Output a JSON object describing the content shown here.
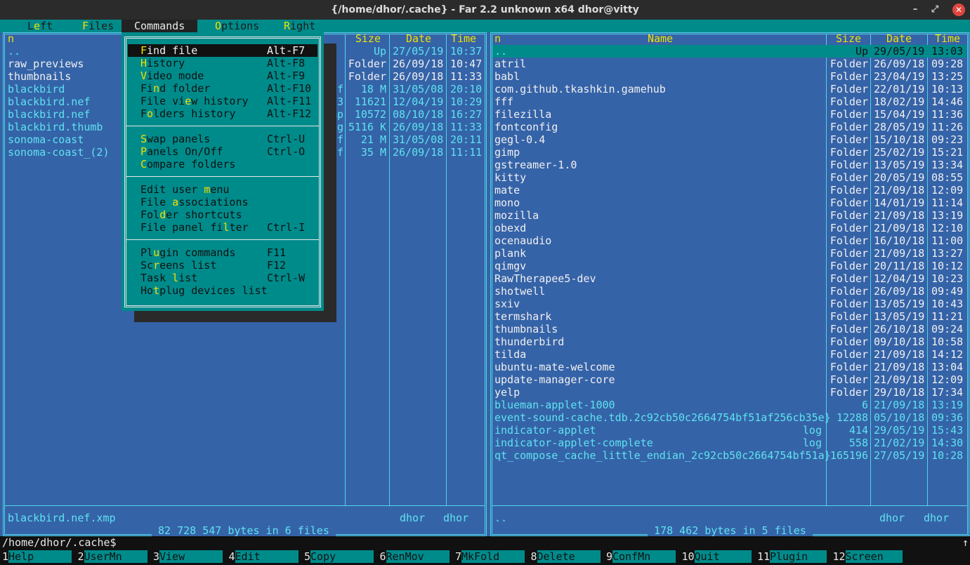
{
  "window": {
    "title": "{/home/dhor/.cache} - Far 2.2 unknown x64 dhor@vitty",
    "minimize": "–",
    "restore": "⤢",
    "close": "✕"
  },
  "menubar": {
    "items": [
      {
        "pre": "L",
        "hot": "e",
        "post": "ft"
      },
      {
        "pre": "",
        "hot": "F",
        "post": "iles"
      },
      {
        "pre": "",
        "hot": "C",
        "post": "ommands"
      },
      {
        "pre": "",
        "hot": "O",
        "post": "ptions"
      },
      {
        "pre": "",
        "hot": "R",
        "post": "ight"
      }
    ]
  },
  "left": {
    "col_name": "n",
    "col_size": "Size",
    "col_date": "Date",
    "col_time": "Time",
    "rows": [
      {
        "name": "..",
        "ext": "",
        "size": "Up",
        "date": "27/05/19",
        "time": "10:37",
        "cls": "cyan"
      },
      {
        "name": "raw_previews",
        "ext": "",
        "size": "Folder",
        "date": "26/09/18",
        "time": "10:47",
        "cls": "white"
      },
      {
        "name": "thumbnails",
        "ext": "",
        "size": "Folder",
        "date": "26/09/18",
        "time": "11:33",
        "cls": "white"
      },
      {
        "name": "blackbird",
        "ext": "nef",
        "size": "18 M",
        "date": "31/05/08",
        "time": "20:10",
        "cls": "cyan"
      },
      {
        "name": "blackbird.nef",
        "ext": "pp3",
        "size": "11621",
        "date": "12/04/19",
        "time": "10:29",
        "cls": "cyan"
      },
      {
        "name": "blackbird.nef",
        "ext": "xmp",
        "size": "10572",
        "date": "08/10/18",
        "time": "16:27",
        "cls": "cyan"
      },
      {
        "name": "blackbird.thumb",
        "ext": "jpg",
        "size": "5116 K",
        "date": "26/09/18",
        "time": "11:33",
        "cls": "cyan"
      },
      {
        "name": "sonoma-coast",
        "ext": "nef",
        "size": "21 M",
        "date": "31/05/08",
        "time": "20:11",
        "cls": "cyan"
      },
      {
        "name": "sonoma-coast_(2)",
        "ext": "iff",
        "size": "35 M",
        "date": "26/09/18",
        "time": "11:11",
        "cls": "cyan"
      }
    ],
    "current_file": "blackbird.nef.xmp",
    "owner1": "dhor",
    "owner2": "dhor",
    "summary": " 82 728 547 bytes in 6 files "
  },
  "right": {
    "col_name": "n",
    "col_name2": "Name",
    "col_size": "Size",
    "col_date": "Date",
    "col_time": "Time",
    "rows": [
      {
        "name": "..",
        "ext": "",
        "size": "Up",
        "date": "29/05/19",
        "time": "13:03",
        "cls": "sel"
      },
      {
        "name": "atril",
        "ext": "",
        "size": "Folder",
        "date": "26/09/18",
        "time": "09:28",
        "cls": "white"
      },
      {
        "name": "babl",
        "ext": "",
        "size": "Folder",
        "date": "23/04/19",
        "time": "13:25",
        "cls": "white"
      },
      {
        "name": "com.github.tkashkin.gamehub",
        "ext": "",
        "size": "Folder",
        "date": "22/01/19",
        "time": "10:13",
        "cls": "white"
      },
      {
        "name": "fff",
        "ext": "",
        "size": "Folder",
        "date": "18/02/19",
        "time": "14:46",
        "cls": "white"
      },
      {
        "name": "filezilla",
        "ext": "",
        "size": "Folder",
        "date": "15/04/19",
        "time": "11:36",
        "cls": "white"
      },
      {
        "name": "fontconfig",
        "ext": "",
        "size": "Folder",
        "date": "28/05/19",
        "time": "11:26",
        "cls": "white"
      },
      {
        "name": "gegl-0.4",
        "ext": "",
        "size": "Folder",
        "date": "15/10/18",
        "time": "09:23",
        "cls": "white"
      },
      {
        "name": "gimp",
        "ext": "",
        "size": "Folder",
        "date": "25/02/19",
        "time": "15:21",
        "cls": "white"
      },
      {
        "name": "gstreamer-1.0",
        "ext": "",
        "size": "Folder",
        "date": "13/05/19",
        "time": "13:34",
        "cls": "white"
      },
      {
        "name": "kitty",
        "ext": "",
        "size": "Folder",
        "date": "20/05/19",
        "time": "08:55",
        "cls": "white"
      },
      {
        "name": "mate",
        "ext": "",
        "size": "Folder",
        "date": "21/09/18",
        "time": "12:09",
        "cls": "white"
      },
      {
        "name": "mono",
        "ext": "",
        "size": "Folder",
        "date": "14/01/19",
        "time": "11:14",
        "cls": "white"
      },
      {
        "name": "mozilla",
        "ext": "",
        "size": "Folder",
        "date": "21/09/18",
        "time": "13:19",
        "cls": "white"
      },
      {
        "name": "obexd",
        "ext": "",
        "size": "Folder",
        "date": "21/09/18",
        "time": "12:10",
        "cls": "white"
      },
      {
        "name": "ocenaudio",
        "ext": "",
        "size": "Folder",
        "date": "16/10/18",
        "time": "11:00",
        "cls": "white"
      },
      {
        "name": "plank",
        "ext": "",
        "size": "Folder",
        "date": "21/09/18",
        "time": "13:27",
        "cls": "white"
      },
      {
        "name": "qimgv",
        "ext": "",
        "size": "Folder",
        "date": "20/11/18",
        "time": "10:12",
        "cls": "white"
      },
      {
        "name": "RawTherapee5-dev",
        "ext": "",
        "size": "Folder",
        "date": "12/04/19",
        "time": "10:23",
        "cls": "white"
      },
      {
        "name": "shotwell",
        "ext": "",
        "size": "Folder",
        "date": "26/09/18",
        "time": "09:49",
        "cls": "white"
      },
      {
        "name": "sxiv",
        "ext": "",
        "size": "Folder",
        "date": "13/05/19",
        "time": "10:43",
        "cls": "white"
      },
      {
        "name": "termshark",
        "ext": "",
        "size": "Folder",
        "date": "13/05/19",
        "time": "11:21",
        "cls": "white"
      },
      {
        "name": "thumbnails",
        "ext": "",
        "size": "Folder",
        "date": "26/10/18",
        "time": "09:24",
        "cls": "white"
      },
      {
        "name": "thunderbird",
        "ext": "",
        "size": "Folder",
        "date": "09/10/18",
        "time": "10:58",
        "cls": "white"
      },
      {
        "name": "tilda",
        "ext": "",
        "size": "Folder",
        "date": "21/09/18",
        "time": "14:12",
        "cls": "white"
      },
      {
        "name": "ubuntu-mate-welcome",
        "ext": "",
        "size": "Folder",
        "date": "21/09/18",
        "time": "13:04",
        "cls": "white"
      },
      {
        "name": "update-manager-core",
        "ext": "",
        "size": "Folder",
        "date": "21/09/18",
        "time": "12:09",
        "cls": "white"
      },
      {
        "name": "yelp",
        "ext": "",
        "size": "Folder",
        "date": "29/10/18",
        "time": "17:34",
        "cls": "white"
      },
      {
        "name": "blueman-applet-1000",
        "ext": "",
        "size": "6",
        "date": "21/09/18",
        "time": "13:19",
        "cls": "cyan"
      },
      {
        "name": "event-sound-cache.tdb.2c92cb50c2664754bf51af256cb35e}",
        "ext": "",
        "size": "12288",
        "date": "05/10/18",
        "time": "09:36",
        "cls": "cyan"
      },
      {
        "name": "indicator-applet",
        "ext": "log",
        "size": "414",
        "date": "29/05/19",
        "time": "15:43",
        "cls": "cyan"
      },
      {
        "name": "indicator-applet-complete",
        "ext": "log",
        "size": "558",
        "date": "21/02/19",
        "time": "14:30",
        "cls": "cyan"
      },
      {
        "name": "qt_compose_cache_little_endian_2c92cb50c2664754bf51a}",
        "ext": "",
        "size": "165196",
        "date": "27/05/19",
        "time": "10:28",
        "cls": "cyan"
      }
    ],
    "current_file": "..",
    "owner1": "dhor",
    "owner2": "dhor",
    "summary": " 178 462 bytes in 5 files "
  },
  "commands_menu": {
    "groups": [
      [
        {
          "pre": "",
          "hot": "F",
          "post": "ind file",
          "key": "Alt-F7",
          "selected": true
        },
        {
          "pre": "",
          "hot": "H",
          "post": "istory",
          "key": "Alt-F8"
        },
        {
          "pre": "",
          "hot": "V",
          "post": "ideo mode",
          "key": "Alt-F9"
        },
        {
          "pre": "Fi",
          "hot": "n",
          "post": "d folder",
          "key": "Alt-F10"
        },
        {
          "pre": "File vi",
          "hot": "e",
          "post": "w history",
          "key": "Alt-F11"
        },
        {
          "pre": "F",
          "hot": "o",
          "post": "lders history",
          "key": "Alt-F12"
        }
      ],
      [
        {
          "pre": "",
          "hot": "S",
          "post": "wap panels",
          "key": "Ctrl-U"
        },
        {
          "pre": "",
          "hot": "P",
          "post": "anels On/Off",
          "key": "Ctrl-O"
        },
        {
          "pre": "",
          "hot": "C",
          "post": "ompare folders",
          "key": ""
        }
      ],
      [
        {
          "pre": "Edit user ",
          "hot": "m",
          "post": "enu",
          "key": ""
        },
        {
          "pre": "File ",
          "hot": "a",
          "post": "ssociations",
          "key": ""
        },
        {
          "pre": "Fol",
          "hot": "d",
          "post": "er shortcuts",
          "key": ""
        },
        {
          "pre": "File panel fi",
          "hot": "l",
          "post": "ter",
          "key": "Ctrl-I"
        }
      ],
      [
        {
          "pre": "Pl",
          "hot": "u",
          "post": "gin commands",
          "key": "F11"
        },
        {
          "pre": "Sc",
          "hot": "r",
          "post": "eens list",
          "key": "F12"
        },
        {
          "pre": "Task ",
          "hot": "l",
          "post": "ist",
          "key": "Ctrl-W"
        },
        {
          "pre": "Ho",
          "hot": "t",
          "post": "plug devices list",
          "key": ""
        }
      ]
    ]
  },
  "cmdline": {
    "prompt": "/home/dhor/.cache$",
    "scroll": "↑"
  },
  "keybar": [
    {
      "num": "1",
      "label": "Help"
    },
    {
      "num": "2",
      "label": "UserMn"
    },
    {
      "num": "3",
      "label": "View"
    },
    {
      "num": "4",
      "label": "Edit"
    },
    {
      "num": "5",
      "label": "Copy"
    },
    {
      "num": "6",
      "label": "RenMov"
    },
    {
      "num": "7",
      "label": "MkFold"
    },
    {
      "num": "8",
      "label": "Delete"
    },
    {
      "num": "9",
      "label": "ConfMn"
    },
    {
      "num": "10",
      "label": "Quit"
    },
    {
      "num": "11",
      "label": "Plugin"
    },
    {
      "num": "12",
      "label": "Screen"
    }
  ],
  "colors": {
    "panel_bg": "#3563a8",
    "frame": "#4fd6e6",
    "menu_bg": "#008b8b",
    "hotkey": "#f0e000"
  }
}
